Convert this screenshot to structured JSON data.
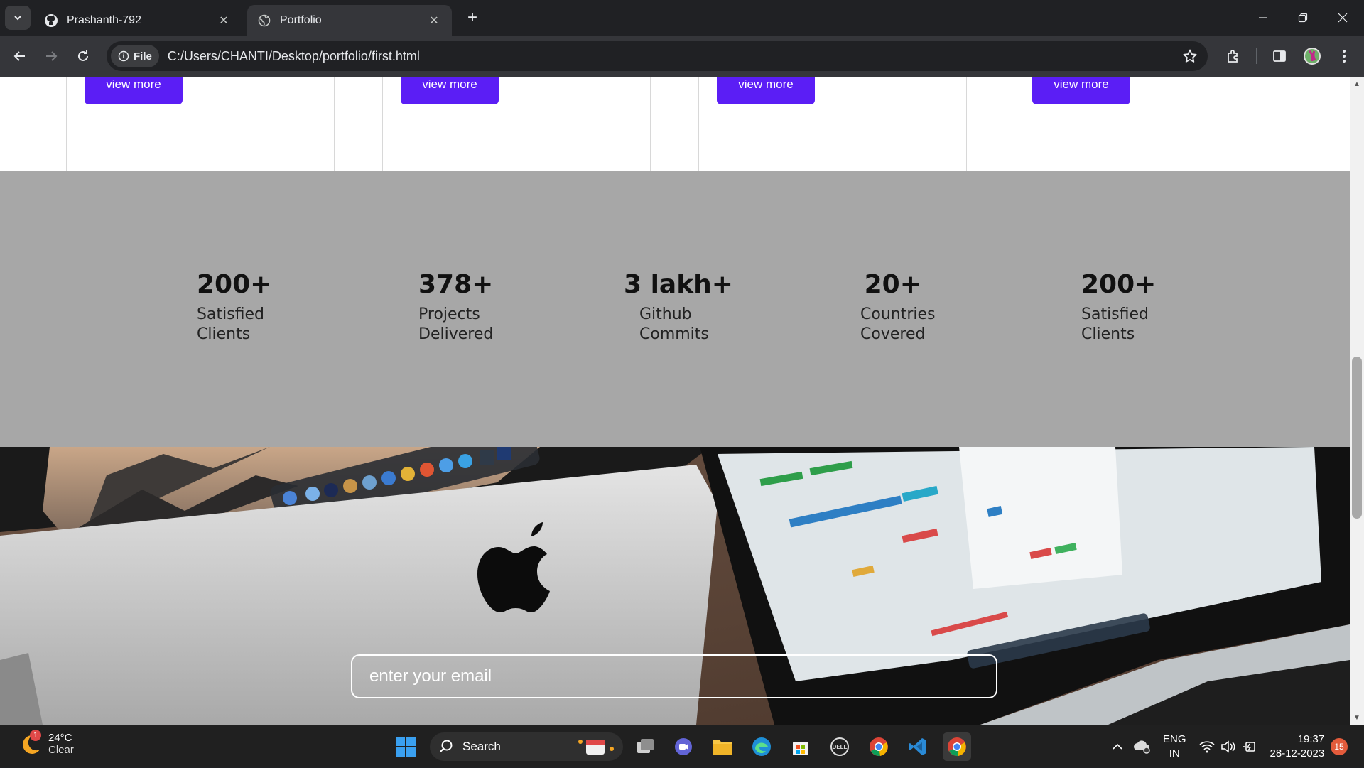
{
  "browser": {
    "tabs": [
      {
        "title": "Prashanth-792",
        "icon": "github-icon",
        "active": false
      },
      {
        "title": "Portfolio",
        "icon": "globe-icon",
        "active": true
      }
    ],
    "file_chip": "File",
    "url": "C:/Users/CHANTI/Desktop/portfolio/first.html"
  },
  "page": {
    "cards": [
      {
        "button": "view more"
      },
      {
        "button": "view more"
      },
      {
        "button": "view more"
      },
      {
        "button": "view more"
      }
    ],
    "stats": [
      {
        "value": "200+",
        "line1": "Satisfied",
        "line2": "Clients"
      },
      {
        "value": "378+",
        "line1": "Projects",
        "line2": "Delivered"
      },
      {
        "value": "3 lakh+",
        "line1": "Github",
        "line2": "Commits"
      },
      {
        "value": "20+",
        "line1": "Countries",
        "line2": "Covered"
      },
      {
        "value": "200+",
        "line1": "Satisfied",
        "line2": "Clients"
      }
    ],
    "newsletter": {
      "placeholder": "enter your email"
    },
    "colors": {
      "stats_bg": "#a7a7a7",
      "button": "#5b1ef5"
    }
  },
  "taskbar": {
    "weather": {
      "temp": "24°C",
      "condition": "Clear",
      "badge": "1"
    },
    "search_label": "Search",
    "language": {
      "line1": "ENG",
      "line2": "IN"
    },
    "clock": {
      "time": "19:37",
      "date": "28-12-2023"
    },
    "notifications": "15"
  }
}
